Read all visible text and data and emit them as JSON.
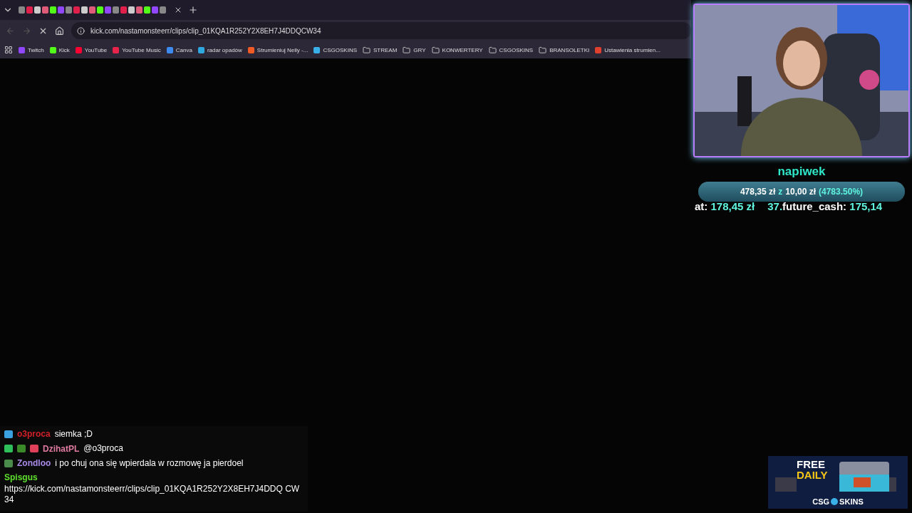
{
  "browser": {
    "address": "kick.com/nastamonsteerr/clips/clip_01KQA1R252Y2X8EH7J4DDQCW34",
    "bookmarks": [
      {
        "label": "Twitch",
        "kind": "site",
        "color": "#9146ff"
      },
      {
        "label": "Kick",
        "kind": "site",
        "color": "#53fc18"
      },
      {
        "label": "YouTube",
        "kind": "site",
        "color": "#ff0033"
      },
      {
        "label": "YouTube Music",
        "kind": "site",
        "color": "#e8244a"
      },
      {
        "label": "Canva",
        "kind": "site",
        "color": "#3d8bf0"
      },
      {
        "label": "radar opadów",
        "kind": "site",
        "color": "#2fa8e0"
      },
      {
        "label": "Strumieniuj Nelly -...",
        "kind": "site",
        "color": "#f05a24"
      },
      {
        "label": "CSGOSKINS",
        "kind": "site",
        "color": "#3ab0e8"
      },
      {
        "label": "STREAM",
        "kind": "folder"
      },
      {
        "label": "GRY",
        "kind": "folder"
      },
      {
        "label": "KONWERTERY",
        "kind": "folder"
      },
      {
        "label": "CSGOSKINS",
        "kind": "folder"
      },
      {
        "label": "BRANSOLETKI",
        "kind": "folder"
      },
      {
        "label": "Ustawienia strumien...",
        "kind": "site",
        "color": "#e0402e"
      }
    ]
  },
  "tip_goal": {
    "title": "napiwek",
    "current": "478,35 zł",
    "separator": "z",
    "target": "10,00 zł",
    "percent": "(4783.50%)",
    "level": 1
  },
  "ticker": [
    {
      "name": "at:",
      "amount": "178,45 zł"
    },
    {
      "rank": "37.",
      "name": "future_cash:",
      "amount": "175,14"
    }
  ],
  "chat": [
    {
      "user": "o3proca",
      "color": "#d0202a",
      "text": "siemka ;D",
      "kind": "inline"
    },
    {
      "user": "DzihatPL",
      "color": "#e07aa0",
      "text": "@o3proca",
      "kind": "inline"
    },
    {
      "user": "Zondloo",
      "color": "#a98ae8",
      "text": "i po chuj ona się wpierdala w rozmowę ja pierdoel",
      "kind": "inline"
    },
    {
      "user": "Spisgus",
      "color": "#5ee02e",
      "text": "https://kick.com/nastamonsteerr/clips/clip_01KQA1R252Y2X8EH7J4DDQ CW34",
      "kind": "block"
    }
  ],
  "ad": {
    "line1": "FREE",
    "line2": "DAILY",
    "brand_left": "CSG",
    "brand_right": "SKINS"
  }
}
